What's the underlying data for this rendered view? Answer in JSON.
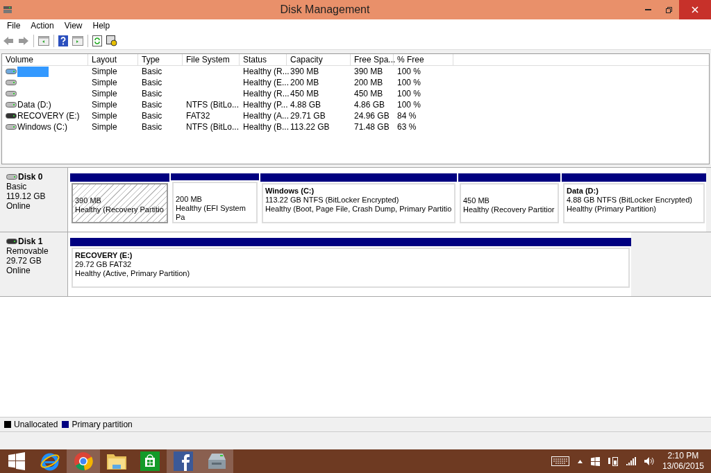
{
  "window": {
    "title": "Disk Management"
  },
  "menu": [
    "File",
    "Action",
    "View",
    "Help"
  ],
  "table": {
    "columns": [
      "Volume",
      "Layout",
      "Type",
      "File System",
      "Status",
      "Capacity",
      "Free Spa...",
      "% Free"
    ],
    "rows": [
      {
        "kind": "fixed",
        "selected": true,
        "cells": [
          "",
          "Simple",
          "Basic",
          "",
          "Healthy (R...",
          "390 MB",
          "390 MB",
          "100 %"
        ]
      },
      {
        "kind": "fixed",
        "selected": false,
        "cells": [
          "",
          "Simple",
          "Basic",
          "",
          "Healthy (E...",
          "200 MB",
          "200 MB",
          "100 %"
        ]
      },
      {
        "kind": "fixed",
        "selected": false,
        "cells": [
          "",
          "Simple",
          "Basic",
          "",
          "Healthy (R...",
          "450 MB",
          "450 MB",
          "100 %"
        ]
      },
      {
        "kind": "fixed",
        "selected": false,
        "cells": [
          "Data (D:)",
          "Simple",
          "Basic",
          "NTFS (BitLo...",
          "Healthy (P...",
          "4.88 GB",
          "4.86 GB",
          "100 %"
        ]
      },
      {
        "kind": "removable",
        "selected": false,
        "cells": [
          "RECOVERY (E:)",
          "Simple",
          "Basic",
          "FAT32",
          "Healthy (A...",
          "29.71 GB",
          "24.96 GB",
          "84 %"
        ]
      },
      {
        "kind": "fixed",
        "selected": false,
        "cells": [
          "Windows (C:)",
          "Simple",
          "Basic",
          "NTFS (BitLo...",
          "Healthy (B...",
          "113.22 GB",
          "71.48 GB",
          "63 %"
        ]
      }
    ]
  },
  "disks": [
    {
      "kind": "fixed",
      "name": "Disk 0",
      "type": "Basic",
      "size": "119.12 GB",
      "state": "Online",
      "partitions": [
        {
          "selected": true,
          "size": "390 MB",
          "status": "Healthy (Recovery Partitio"
        },
        {
          "selected": false,
          "size": "200 MB",
          "status": "Healthy (EFI System Pa"
        },
        {
          "selected": false,
          "name": "Windows  (C:)",
          "size": "113.22 GB NTFS (BitLocker Encrypted)",
          "status": "Healthy (Boot, Page File, Crash Dump, Primary Partitio"
        },
        {
          "selected": false,
          "size": "450 MB",
          "status": "Healthy (Recovery Partitior"
        },
        {
          "selected": false,
          "name": "Data  (D:)",
          "size": "4.88 GB NTFS (BitLocker Encrypted)",
          "status": "Healthy (Primary Partition)"
        }
      ]
    },
    {
      "kind": "removable",
      "name": "Disk 1",
      "type": "Removable",
      "size": "29.72 GB",
      "state": "Online",
      "partitions": [
        {
          "selected": false,
          "name": "RECOVERY  (E:)",
          "size": "29.72 GB FAT32",
          "status": "Healthy (Active, Primary Partition)"
        }
      ]
    }
  ],
  "legend": [
    {
      "label": "Unallocated",
      "color": "#000000"
    },
    {
      "label": "Primary partition",
      "color": "#000080"
    }
  ],
  "taskbar": {
    "apps": [
      {
        "kind": "start",
        "selected": false
      },
      {
        "kind": "ie",
        "selected": false
      },
      {
        "kind": "chrome",
        "selected": true
      },
      {
        "kind": "folder",
        "selected": false
      },
      {
        "kind": "store",
        "selected": false
      },
      {
        "kind": "facebook",
        "selected": true
      },
      {
        "kind": "disk",
        "selected": true
      }
    ],
    "time": "2:10 PM",
    "date": "13/06/2015"
  }
}
